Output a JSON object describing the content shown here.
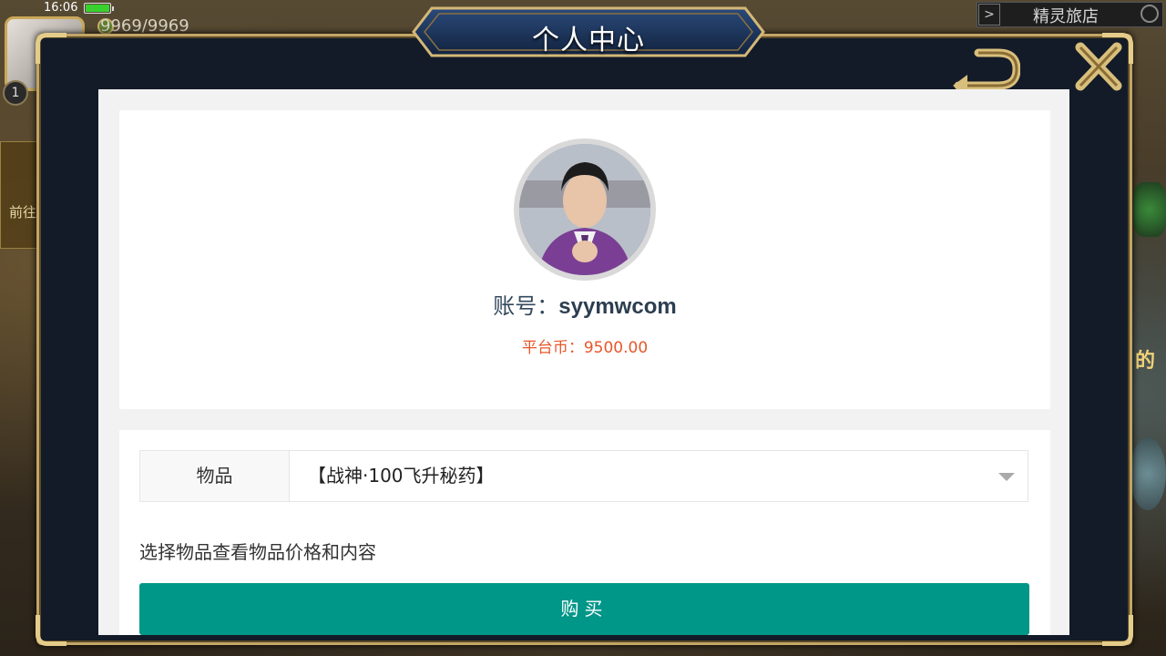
{
  "status_bar": {
    "time": "16:06"
  },
  "hud": {
    "hp": "9969/9969",
    "level": "1",
    "quest_text": "前往",
    "shop_label": "精灵旅店",
    "right_text": "的"
  },
  "modal": {
    "title": "个人中心",
    "back_icon": "return-arrow-icon",
    "close_icon": "close-x-icon"
  },
  "profile": {
    "account_label": "账号：",
    "account_value": "syymwcom",
    "coin_label": "平台币：",
    "coin_value": "9500.00"
  },
  "purchase": {
    "item_label": "物品",
    "selected_item": "【战神·100飞升秘药】",
    "hint": "选择物品查看物品价格和内容",
    "buy_label": "购买"
  },
  "colors": {
    "accent": "#009688",
    "coin": "#e8572a",
    "frame_gold": "#c3a566",
    "modal_bg": "#131b28"
  }
}
